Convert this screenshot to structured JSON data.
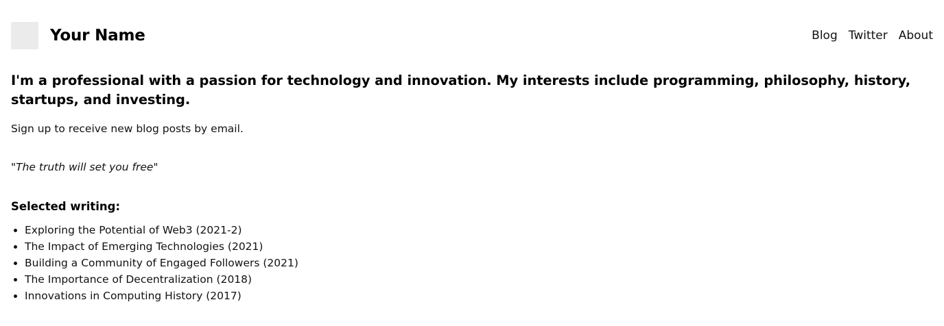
{
  "header": {
    "site_name": "Your Name",
    "nav": [
      {
        "label": "Blog"
      },
      {
        "label": "Twitter"
      },
      {
        "label": "About"
      }
    ]
  },
  "intro": "I'm a professional with a passion for technology and innovation. My interests include programming, philosophy, history, startups, and investing.",
  "signup_text": "Sign up to receive new blog posts by email.",
  "quote": "\"The truth will set you free\"",
  "writing": {
    "heading": "Selected writing:",
    "items": [
      {
        "label": "Exploring the Potential of Web3 (2021-2)"
      },
      {
        "label": "The Impact of Emerging Technologies (2021)"
      },
      {
        "label": "Building a Community of Engaged Followers (2021)"
      },
      {
        "label": "The Importance of Decentralization (2018)"
      },
      {
        "label": "Innovations in Computing History (2017)"
      }
    ]
  }
}
